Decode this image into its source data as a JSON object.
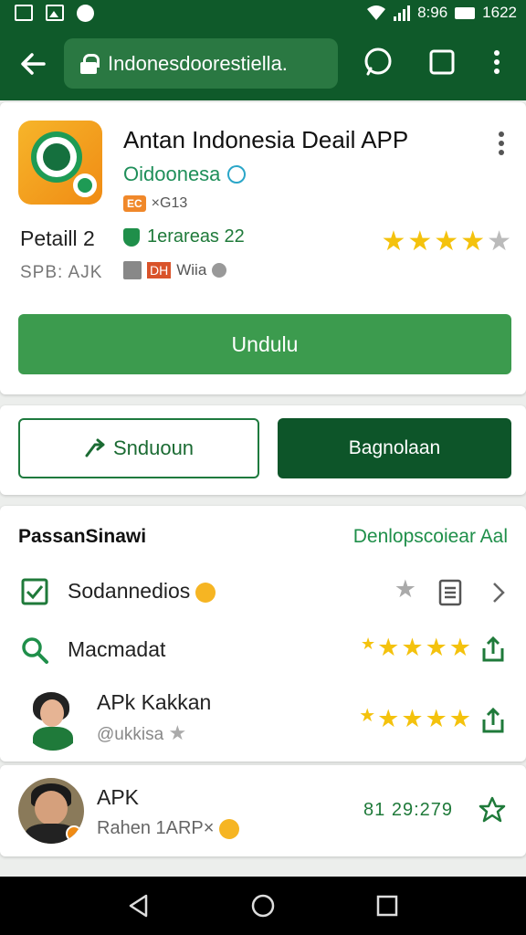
{
  "status_bar": {
    "signal_text": "8:96",
    "time": "1622"
  },
  "toolbar": {
    "url": "Indonesdoorestiella."
  },
  "app": {
    "title": "Antan Indonesia Deail APP",
    "developer": "Oidoonesa",
    "age_badge": "EC",
    "badge_extra": "×G13",
    "rating_label": "Petaill 2",
    "size_label": "SPB: AJK",
    "reviews": "1erareas 22",
    "tag_text": "Wiia",
    "tag_red": "DH",
    "rating": 4.5,
    "install_label": "Undulu"
  },
  "actions": {
    "secondary_label": "Snduoun",
    "primary_label": "Bagnolaan"
  },
  "list": {
    "heading": "PassanSinawi",
    "link": "Denlopscoiear Aal",
    "rows": [
      {
        "label": "Sodannedios"
      },
      {
        "label": "Macmadat",
        "rating": 4.5
      },
      {
        "name": "APk Kakkan",
        "handle": "@ukkisa",
        "rating": 5
      }
    ]
  },
  "last_item": {
    "name": "APK",
    "subtitle": "Rahen 1ARP×",
    "timestamp": "81 29:279"
  },
  "colors": {
    "brand_dark": "#0f5a2a",
    "install_green": "#3c9b4e",
    "star_yellow": "#f4c20d"
  }
}
